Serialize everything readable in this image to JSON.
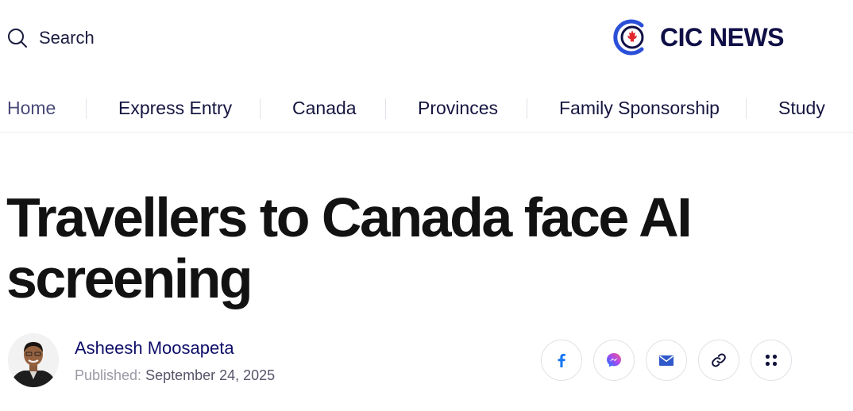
{
  "header": {
    "search_label": "Search",
    "brand": "CIC NEWS"
  },
  "nav": {
    "items": [
      {
        "label": "Home",
        "active": true
      },
      {
        "label": "Express Entry"
      },
      {
        "label": "Canada"
      },
      {
        "label": "Provinces"
      },
      {
        "label": "Family Sponsorship"
      },
      {
        "label": "Study"
      }
    ]
  },
  "article": {
    "title_line1": "Travellers to Canada face AI",
    "title_line2": "screening",
    "author": "Asheesh Moosapeta",
    "published_label": "Published:",
    "published_date": "September 24, 2025"
  },
  "share": {
    "buttons": [
      {
        "icon": "facebook-icon",
        "color": "#1877f2"
      },
      {
        "icon": "messenger-icon",
        "color": "#a24bf2"
      },
      {
        "icon": "email-icon",
        "color": "#2f58c9"
      },
      {
        "icon": "link-icon",
        "color": "#11123a"
      },
      {
        "icon": "more-dots-icon",
        "color": "#11123a"
      }
    ]
  },
  "colors": {
    "brand_navy": "#101047",
    "brand_blue": "#2b50d8",
    "maple_red": "#e3262b",
    "text_dark": "#121212"
  }
}
